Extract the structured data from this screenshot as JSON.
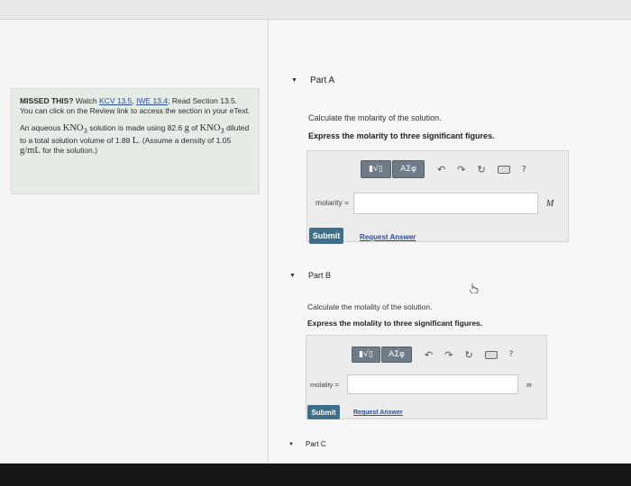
{
  "left_panel": {
    "info_text": {
      "missed": "MISSED THIS?",
      "watch": " Watch ",
      "link1": "KCV 13.5",
      "sep": ", ",
      "link2": "IWE 13.4",
      "after": "; Read Section 13.5. You can click on the Review link to access the section in your eText."
    },
    "problem": {
      "p1": "An aqueous ",
      "kno3": "KNO",
      "sub3": "3",
      "p2": " solution is made using 82.6 ",
      "g": "g",
      "p3": " of ",
      "p4": " diluted to a total solution volume of 1.88 ",
      "L": "L",
      "p5": ". (Assume a density of 1.05 ",
      "density_unit": "g/mL",
      "p6": " for the solution.)"
    }
  },
  "part_a": {
    "title": "Part A",
    "prompt": "Calculate the molarity of the solution.",
    "instruction": "Express the molarity to three significant figures.",
    "toolbar": {
      "templates": "▮√▯",
      "greek": "ΑΣφ",
      "undo": "↶",
      "redo": "↷",
      "reset": "↻",
      "help": "?"
    },
    "field_label": "molarity =",
    "unit": "M",
    "submit": "Submit",
    "request": "Request Answer"
  },
  "part_b": {
    "title": "Part B",
    "prompt": "Calculate the molality of the solution.",
    "instruction": "Express the molality to three significant figures.",
    "toolbar": {
      "templates": "▮√▯",
      "greek": "ΑΣφ",
      "undo": "↶",
      "redo": "↷",
      "reset": "↻",
      "help": "?"
    },
    "field_label": "molality =",
    "unit": "m",
    "submit": "Submit",
    "request": "Request Answer"
  },
  "part_c": {
    "title": "Part C"
  },
  "icons": {
    "collapse": "collapse-caret-icon",
    "pointer": "hand-pointer-icon"
  }
}
